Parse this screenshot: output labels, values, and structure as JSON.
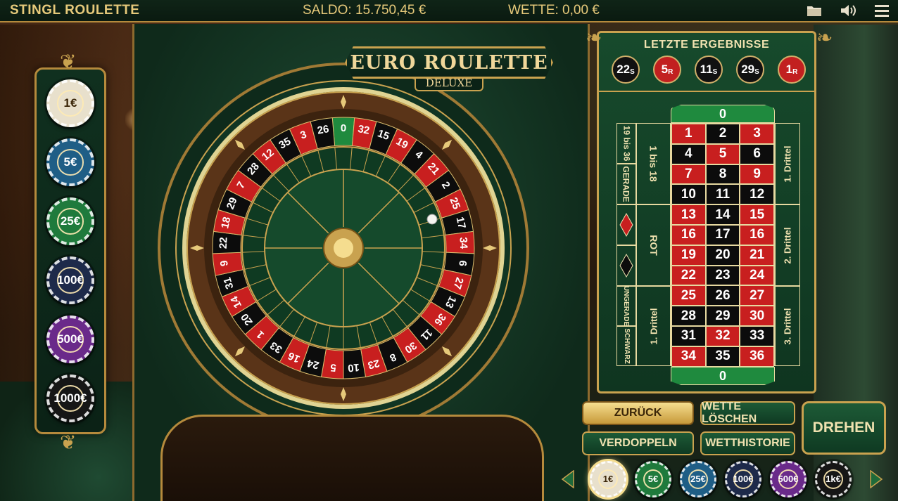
{
  "header": {
    "title": "STINGL ROULETTE",
    "saldo": "SALDO: 15.750,45 €",
    "wette": "WETTE: 0,00 €",
    "icons": [
      "folder-icon",
      "volume-icon",
      "menu-icon"
    ]
  },
  "game_title": {
    "main": "EURO ROULETTE",
    "sub": "DELUXE"
  },
  "left_chips": [
    {
      "label": "1€",
      "color": "#e8e0cc",
      "text": "#3a2508"
    },
    {
      "label": "5€",
      "color": "#1f5e86",
      "text": "#ffffff"
    },
    {
      "label": "25€",
      "color": "#1f7a3c",
      "text": "#ffffff"
    },
    {
      "label": "100€",
      "color": "#1e2a4a",
      "text": "#ffffff"
    },
    {
      "label": "500€",
      "color": "#6a2a8a",
      "text": "#ffffff"
    },
    {
      "label": "1000€",
      "color": "#161616",
      "text": "#ffffff"
    }
  ],
  "wheel": {
    "numbers": [
      "0",
      "32",
      "15",
      "19",
      "4",
      "21",
      "2",
      "25",
      "17",
      "34",
      "6",
      "27",
      "13",
      "36",
      "11",
      "30",
      "8",
      "23",
      "10",
      "5",
      "24",
      "16",
      "33",
      "1",
      "20",
      "14",
      "31",
      "9",
      "22",
      "18",
      "29",
      "7",
      "28",
      "12",
      "35",
      "3",
      "26"
    ],
    "red_numbers": [
      "1",
      "3",
      "5",
      "7",
      "9",
      "12",
      "14",
      "16",
      "18",
      "19",
      "21",
      "23",
      "25",
      "27",
      "30",
      "32",
      "34",
      "36"
    ]
  },
  "last_results": {
    "title": "LETZTE ERGEBNISSE",
    "items": [
      {
        "num": "22",
        "tag": "S",
        "color": "black"
      },
      {
        "num": "5",
        "tag": "R",
        "color": "red"
      },
      {
        "num": "11",
        "tag": "S",
        "color": "black"
      },
      {
        "num": "29",
        "tag": "S",
        "color": "black"
      },
      {
        "num": "1",
        "tag": "R",
        "color": "red"
      }
    ]
  },
  "board": {
    "zero": "0",
    "rows": [
      [
        {
          "n": "1",
          "c": "red"
        },
        {
          "n": "2",
          "c": "black"
        },
        {
          "n": "3",
          "c": "red"
        }
      ],
      [
        {
          "n": "4",
          "c": "black"
        },
        {
          "n": "5",
          "c": "red"
        },
        {
          "n": "6",
          "c": "black"
        }
      ],
      [
        {
          "n": "7",
          "c": "red"
        },
        {
          "n": "8",
          "c": "black"
        },
        {
          "n": "9",
          "c": "red"
        }
      ],
      [
        {
          "n": "10",
          "c": "black"
        },
        {
          "n": "11",
          "c": "black"
        },
        {
          "n": "12",
          "c": "black"
        }
      ],
      [
        {
          "n": "13",
          "c": "red"
        },
        {
          "n": "14",
          "c": "black"
        },
        {
          "n": "15",
          "c": "red"
        }
      ],
      [
        {
          "n": "16",
          "c": "red"
        },
        {
          "n": "17",
          "c": "black"
        },
        {
          "n": "16",
          "c": "red"
        }
      ],
      [
        {
          "n": "19",
          "c": "red"
        },
        {
          "n": "20",
          "c": "black"
        },
        {
          "n": "21",
          "c": "red"
        }
      ],
      [
        {
          "n": "22",
          "c": "red"
        },
        {
          "n": "23",
          "c": "black"
        },
        {
          "n": "24",
          "c": "red"
        }
      ],
      [
        {
          "n": "25",
          "c": "red"
        },
        {
          "n": "26",
          "c": "black"
        },
        {
          "n": "27",
          "c": "red"
        }
      ],
      [
        {
          "n": "28",
          "c": "black"
        },
        {
          "n": "29",
          "c": "black"
        },
        {
          "n": "30",
          "c": "red"
        }
      ],
      [
        {
          "n": "31",
          "c": "black"
        },
        {
          "n": "32",
          "c": "red"
        },
        {
          "n": "33",
          "c": "black"
        }
      ],
      [
        {
          "n": "34",
          "c": "red"
        },
        {
          "n": "35",
          "c": "black"
        },
        {
          "n": "36",
          "c": "red"
        }
      ]
    ],
    "left_outer": [
      "19 bis 36",
      "GERADE",
      "UNGERADE",
      "SCHWARZ"
    ],
    "left_inner": [
      "1 bis 18",
      "ROT",
      "1. Drittel"
    ],
    "right": [
      "1. Drittel",
      "2. Drittel",
      "3. Drittel"
    ]
  },
  "buttons": {
    "zurueck": "ZURÜCK",
    "wette_loeschen": "WETTE LÖSCHEN",
    "verdoppeln": "VERDOPPELN",
    "wetthistorie": "WETTHISTORIE",
    "drehen": "DREHEN"
  },
  "tray_chips": [
    {
      "label": "1€",
      "color": "#e8e0cc",
      "text": "#3a2508"
    },
    {
      "label": "5€",
      "color": "#1f7a3c",
      "text": "#ffffff"
    },
    {
      "label": "25€",
      "color": "#1f5e86",
      "text": "#ffffff"
    },
    {
      "label": "100€",
      "color": "#1e2a4a",
      "text": "#ffffff"
    },
    {
      "label": "500€",
      "color": "#6a2a8a",
      "text": "#ffffff"
    },
    {
      "label": "1k€",
      "color": "#161616",
      "text": "#ffffff"
    }
  ]
}
